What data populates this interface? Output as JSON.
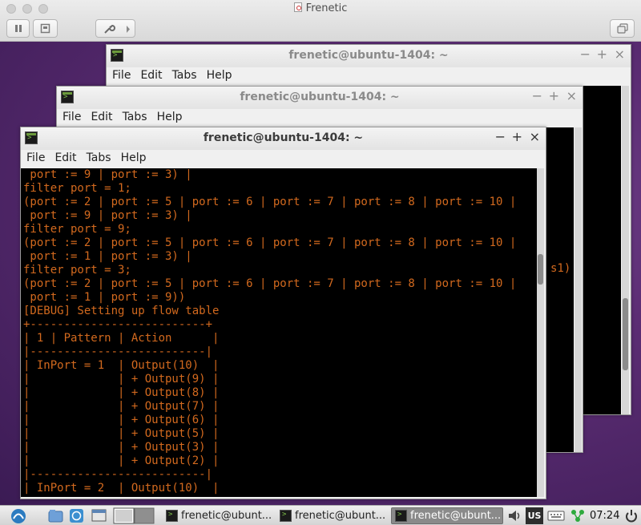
{
  "host": {
    "title": "Frenetic",
    "pause_icon": "pause-icon",
    "stop_icon": "stop-icon",
    "settings_icon": "wrench-icon",
    "forward_icon": "chevron-right-icon",
    "window_icon": "duplicate-window-icon"
  },
  "terminals": [
    {
      "title": "frenetic@ubuntu-1404: ~"
    },
    {
      "title": "frenetic@ubuntu-1404: ~"
    },
    {
      "title": "frenetic@ubuntu-1404: ~"
    }
  ],
  "menu": {
    "file": "File",
    "edit": "Edit",
    "tabs": "Tabs",
    "help": "Help"
  },
  "window_controls": {
    "minimize": "−",
    "maximize": "+",
    "close": "×"
  },
  "back_terminal_text": "s1)",
  "terminal_lines": [
    " port := 9 | port := 3) |",
    "filter port = 1;",
    "(port := 2 | port := 5 | port := 6 | port := 7 | port := 8 | port := 10 |",
    " port := 9 | port := 3) |",
    "filter port = 9;",
    "(port := 2 | port := 5 | port := 6 | port := 7 | port := 8 | port := 10 |",
    " port := 1 | port := 3) |",
    "filter port = 3;",
    "(port := 2 | port := 5 | port := 6 | port := 7 | port := 8 | port := 10 |",
    " port := 1 | port := 9))",
    "[DEBUG] Setting up flow table",
    "+--------------------------+",
    "| 1 | Pattern | Action      |",
    "|--------------------------|",
    "| InPort = 1  | Output(10)  |",
    "|             | + Output(9) |",
    "|             | + Output(8) |",
    "|             | + Output(7) |",
    "|             | + Output(6) |",
    "|             | + Output(5) |",
    "|             | + Output(3) |",
    "|             | + Output(2) |",
    "|--------------------------|",
    "| InPort = 2  | Output(10)  |"
  ],
  "taskbar": {
    "tasks": [
      {
        "label": "frenetic@ubunt..."
      },
      {
        "label": "frenetic@ubunt..."
      },
      {
        "label": "frenetic@ubunt..."
      }
    ],
    "keyboard_layout": "US",
    "clock": "07:24"
  }
}
